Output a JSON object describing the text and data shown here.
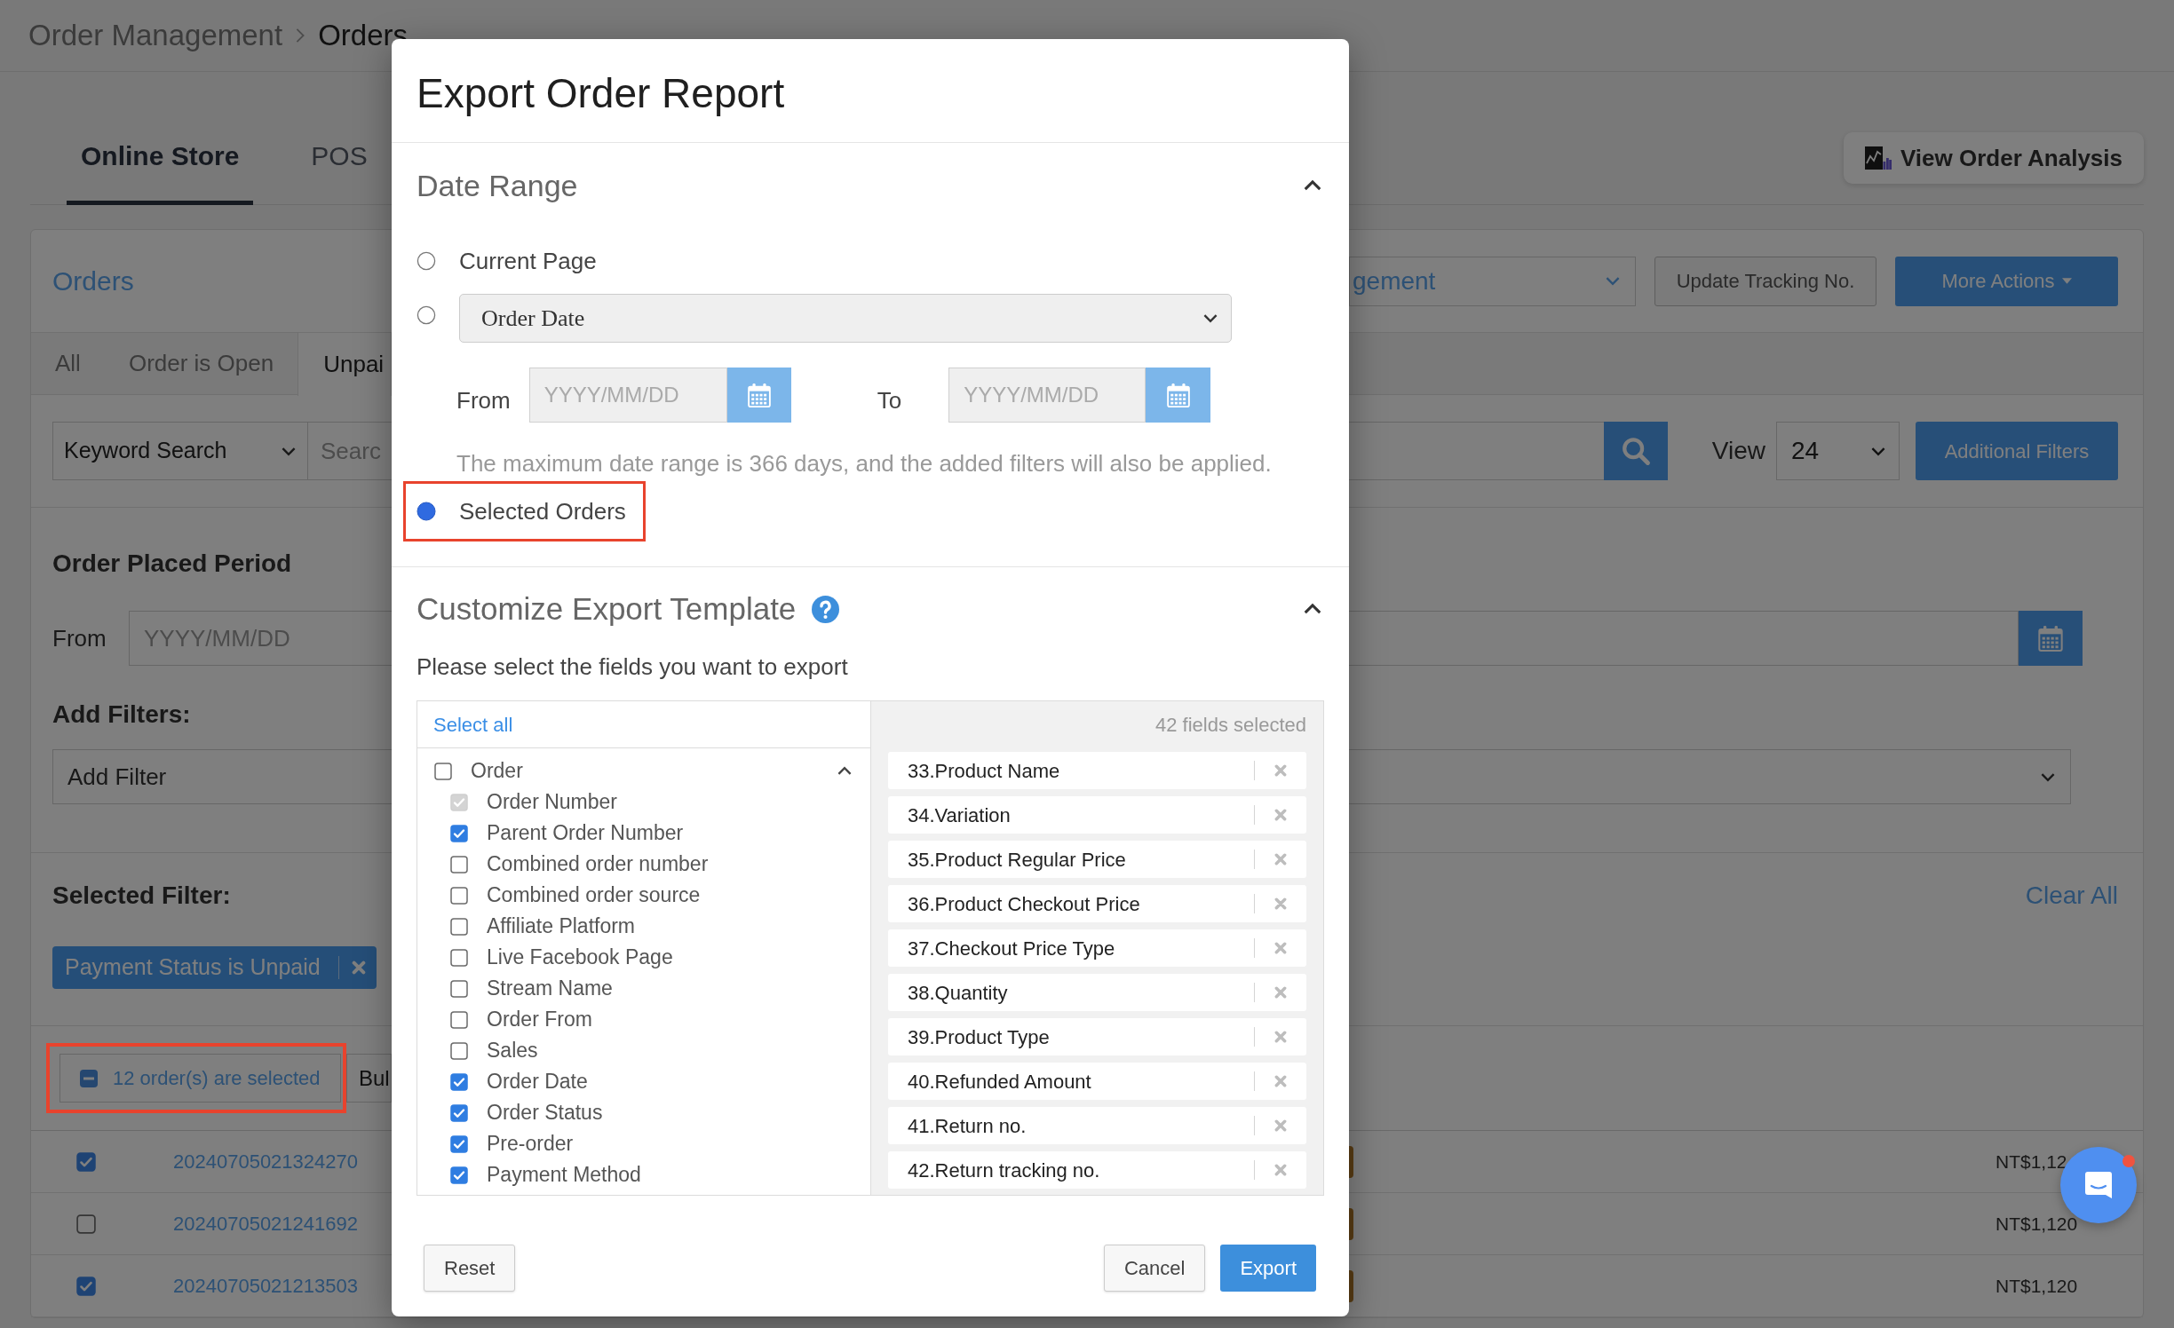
{
  "page": {
    "breadcrumb": [
      "Order Management",
      "Orders"
    ],
    "tabs": [
      {
        "label": "Online Store",
        "selected": true
      },
      {
        "label": "POS",
        "selected": false
      }
    ],
    "analysis_button": {
      "label": "View Order Analysis"
    },
    "orders": {
      "title": "Orders",
      "action_select": {
        "value": "gement"
      },
      "update_tracking_button": {
        "label": "Update Tracking No."
      },
      "more_actions_button": {
        "label": "More Actions"
      },
      "filter_tabs": [
        {
          "label": "All",
          "selected": false
        },
        {
          "label": "Order is Open",
          "selected": false
        },
        {
          "label": "Unpai",
          "selected": true
        }
      ],
      "search_type": {
        "value": "Keyword Search"
      },
      "search": {
        "placeholder": "Searc"
      },
      "view_label": "View",
      "view_select": {
        "value": "24"
      },
      "additional_filters_button": {
        "label": "Additional Filters"
      },
      "period": {
        "title": "Order Placed Period",
        "from_label": "From",
        "from": {
          "placeholder": "YYYY/MM/DD"
        }
      },
      "add_filters": {
        "title": "Add Filters:",
        "select": {
          "value": "Add Filter"
        }
      },
      "selected_filter": {
        "title": "Selected Filter:",
        "clear_all": "Clear All",
        "chips": [
          {
            "label": "Payment Status is Unpaid"
          }
        ]
      },
      "selection": {
        "label": "12 order(s) are selected",
        "highlighted": true
      },
      "bulk_button": {
        "label": "Bul"
      },
      "rows": [
        {
          "checked": true,
          "order_number": "20240705021324270",
          "total": "NT$1,12"
        },
        {
          "checked": false,
          "order_number": "20240705021241692",
          "total": "NT$1,120"
        },
        {
          "checked": true,
          "order_number": "20240705021213503",
          "total": "NT$1,120"
        }
      ]
    }
  },
  "modal": {
    "title": "Export Order Report",
    "date_range": {
      "title": "Date Range",
      "expanded": true,
      "options": [
        {
          "kind": "plain",
          "label": "Current Page",
          "selected": false,
          "highlighted": false
        },
        {
          "kind": "date_filter",
          "selected": false,
          "highlighted": false,
          "select": {
            "value": "Order Date"
          },
          "from_label": "From",
          "from": {
            "placeholder": "YYYY/MM/DD"
          },
          "to_label": "To",
          "to": {
            "placeholder": "YYYY/MM/DD"
          },
          "note": "The maximum date range is 366 days, and the added filters will also be applied."
        },
        {
          "kind": "plain",
          "label": "Selected Orders",
          "selected": true,
          "highlighted": true
        }
      ]
    },
    "template": {
      "title": "Customize Export Template",
      "expanded": true,
      "instruction": "Please select the fields you want to export",
      "select_all": "Select all",
      "count": "42 fields selected",
      "groups": [
        {
          "label": "Order",
          "checked": false,
          "disabled": false,
          "expanded": true,
          "children": [
            {
              "label": "Order Number",
              "checked": true,
              "disabled": true
            },
            {
              "label": "Parent Order Number",
              "checked": true,
              "disabled": false
            },
            {
              "label": "Combined order number",
              "checked": false,
              "disabled": false
            },
            {
              "label": "Combined order source",
              "checked": false,
              "disabled": false
            },
            {
              "label": "Affiliate Platform",
              "checked": false,
              "disabled": false
            },
            {
              "label": "Live Facebook Page",
              "checked": false,
              "disabled": false
            },
            {
              "label": "Stream Name",
              "checked": false,
              "disabled": false
            },
            {
              "label": "Order From",
              "checked": false,
              "disabled": false
            },
            {
              "label": "Sales",
              "checked": false,
              "disabled": false
            },
            {
              "label": "Order Date",
              "checked": true,
              "disabled": false
            },
            {
              "label": "Order Status",
              "checked": true,
              "disabled": false
            },
            {
              "label": "Pre-order",
              "checked": true,
              "disabled": false
            },
            {
              "label": "Payment Method",
              "checked": true,
              "disabled": false
            }
          ]
        }
      ],
      "selected_fields": [
        {
          "label": "33.Product Name"
        },
        {
          "label": "34.Variation"
        },
        {
          "label": "35.Product Regular Price"
        },
        {
          "label": "36.Product Checkout Price"
        },
        {
          "label": "37.Checkout Price Type"
        },
        {
          "label": "38.Quantity"
        },
        {
          "label": "39.Product Type"
        },
        {
          "label": "40.Refunded Amount"
        },
        {
          "label": "41.Return no."
        },
        {
          "label": "42.Return tracking no."
        }
      ]
    },
    "footer": {
      "left": [
        {
          "kind": "default",
          "label": "Reset"
        }
      ],
      "right": [
        {
          "kind": "default",
          "label": "Cancel"
        },
        {
          "kind": "primary",
          "label": "Export"
        }
      ]
    }
  },
  "chat_button": {
    "unread": true
  }
}
